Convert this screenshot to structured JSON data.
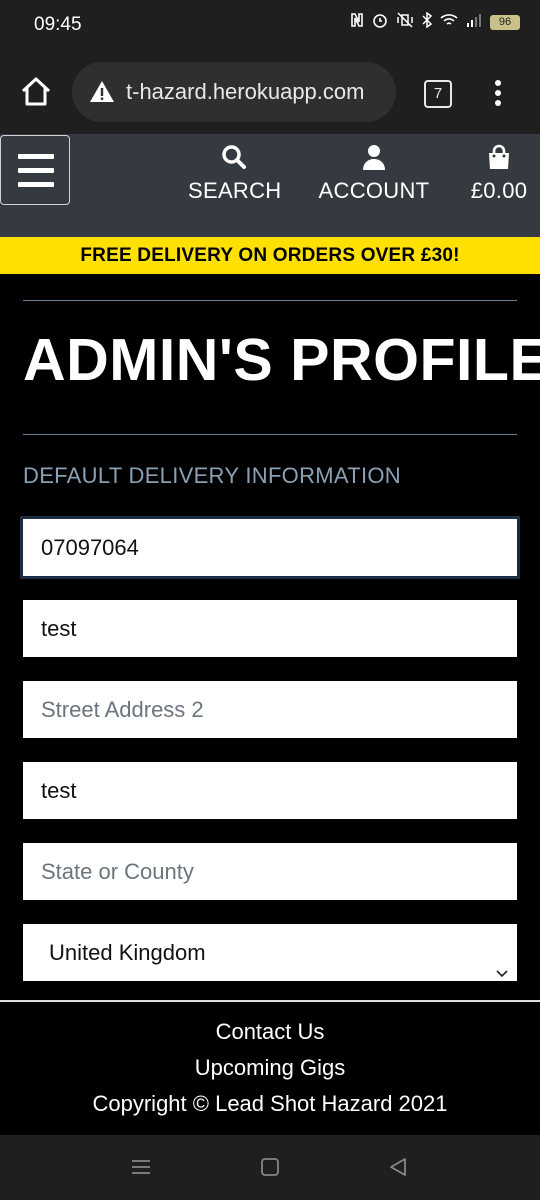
{
  "status_bar": {
    "time": "09:45",
    "battery": "96"
  },
  "browser": {
    "url": "t-hazard.herokuapp.com",
    "tab_count": "7"
  },
  "nav": {
    "search_label": "SEARCH",
    "account_label": "ACCOUNT",
    "cart_total": "£0.00"
  },
  "promo": {
    "text": "FREE DELIVERY ON ORDERS OVER £30!"
  },
  "page": {
    "title": "ADMIN'S PROFILE",
    "section_heading": "DEFAULT DELIVERY INFORMATION"
  },
  "form": {
    "field_1": {
      "value": "07097064",
      "placeholder": ""
    },
    "field_2": {
      "value": "test",
      "placeholder": ""
    },
    "street_address_2": {
      "value": "",
      "placeholder": "Street Address 2"
    },
    "field_4": {
      "value": "test",
      "placeholder": ""
    },
    "county": {
      "value": "",
      "placeholder": "State or County"
    },
    "country": {
      "selected": "United Kingdom"
    }
  },
  "footer": {
    "contact": "Contact Us",
    "gigs": "Upcoming Gigs",
    "copyright": "Copyright © Lead Shot Hazard 2021"
  },
  "colors": {
    "banner": "#ffe000",
    "navbar": "#343a40",
    "heading_muted": "#8aa0b5",
    "divider": "#6b8096"
  }
}
